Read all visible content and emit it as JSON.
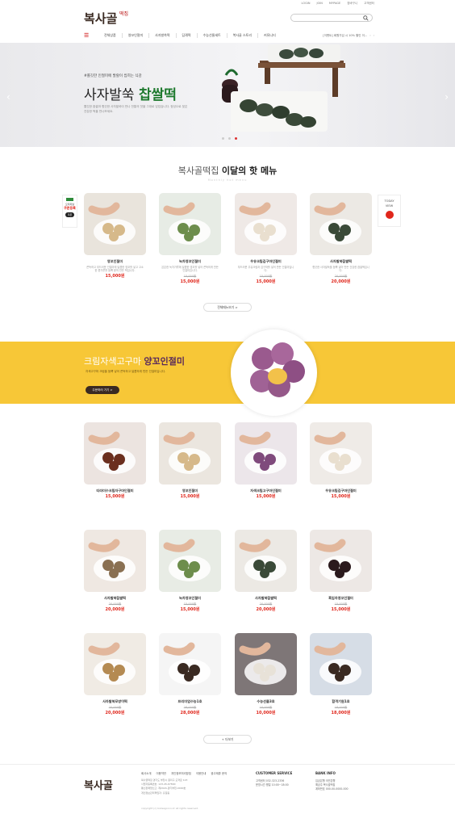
{
  "top_links": [
    "LOGIN",
    "JOIN",
    "MYPAGE",
    "장바구니",
    "고객센터"
  ],
  "brand": {
    "name": "복사골",
    "sub": "떡집"
  },
  "nav": {
    "items": [
      "전체상품",
      "영꼬인절미",
      "사자발쑥떡",
      "답례떡",
      "수능선물세트",
      "복사골 스토리",
      "커뮤니티"
    ],
    "notice": "[이벤트] 회원가입 시 10% 할인 이..."
  },
  "hero": {
    "kicker": "#쫄깃한 인절미에 발랄이 씹히는 식감",
    "title_pre": "사자발쑥 ",
    "title_bold": "찹쌀떡",
    "desc": "쫄깃한 찹쌀과 향긋한 사자발쑥이 만나 전통의 맛을 그대로 담았습니다. 정성으로 빚은 건강한 떡을 만나보세요."
  },
  "monthly": {
    "title_pre": "복사골떡집 ",
    "title_bold": "이달의 핫 메뉴",
    "sub": "Monthly hot menu",
    "more": "전체메뉴보기 >"
  },
  "side_left": {
    "top": "오리지날",
    "mid": "오리지날",
    "red": "쿠폰등록",
    "btn": "쿠폰"
  },
  "side_right": {
    "l1": "TODAY",
    "l2": "VIEW"
  },
  "hot_products": [
    {
      "name": "영꼬인절미",
      "desc": "쫀득하고 부드러운 인절미에 달콤한 영꼬를 넣고 고소한 콩가루를 듬뿍 묻혀 만든 떡입니다.",
      "old": "",
      "price": "15,000원"
    },
    {
      "name": "녹차영꼬인절미",
      "desc": "은은한 녹차가루에 달콤한 영꼬를 넣어 쫀득하게 만든 인절미입니다.",
      "old": "15,000원",
      "price": "15,000원"
    },
    {
      "name": "우유크림김구마인절미",
      "desc": "부드러운 우유크림과 김구마를 넣어 만든 인절미입니다.",
      "old": "15,000원",
      "price": "15,000원"
    },
    {
      "name": "사자발쑥찹쌀떡",
      "desc": "향긋한 사자발쑥을 듬뿍 넣어 만든 건강한 찹쌀떡입니다.",
      "old": "20,000원",
      "price": "20,000원"
    }
  ],
  "yellow_banner": {
    "title_pre": "크림자색고구마 ",
    "title_bold": "양꼬인절미",
    "sub": "자색고구마 크림을 듬뿍 넣어 쫀득하고 달콤하게 만든 인절미입니다.",
    "btn": "주문하러 가기 >"
  },
  "products": [
    {
      "name": "티라미수크림자구마인절미",
      "desc": "",
      "old": "",
      "price": "15,000원"
    },
    {
      "name": "영꼬인절미",
      "desc": "",
      "old": "",
      "price": "15,000원"
    },
    {
      "name": "자색크림고구마인절미",
      "desc": "",
      "old": "",
      "price": "15,000원"
    },
    {
      "name": "우유크림김구마인절미",
      "desc": "",
      "old": "",
      "price": "15,000원"
    },
    {
      "name": "사자발쑥찹쌀떡",
      "desc": "",
      "old": "20,000원",
      "price": "20,000원"
    },
    {
      "name": "녹차영꼬인절미",
      "desc": "",
      "old": "15,000원",
      "price": "15,000원"
    },
    {
      "name": "사자발쑥찹쌀떡",
      "desc": "",
      "old": "20,000원",
      "price": "20,000원"
    },
    {
      "name": "흑임자영꼬인절미",
      "desc": "",
      "old": "15,000원",
      "price": "15,000원"
    },
    {
      "name": "사자발쑥모방이떡",
      "desc": "",
      "old": "20,000원",
      "price": "20,000원"
    },
    {
      "name": "프리미엄수능1호",
      "desc": "",
      "old": "28,000원",
      "price": "28,000원"
    },
    {
      "name": "수능선물3호",
      "desc": "",
      "old": "10,000원",
      "price": "10,000원"
    },
    {
      "name": "합격기원1호",
      "desc": "",
      "old": "18,000원",
      "price": "18,000원"
    }
  ],
  "more2": "+ 더보기",
  "footer": {
    "nav": [
      "회사소개",
      "이용약관",
      "개인정보처리방침",
      "이용안내",
      "광고제휴 문의"
    ],
    "info": [
      "복사골떡집 경기도 부천시 원미구 도약로 123",
      "사업자등록번호: 123-45-67890",
      "통신판매업신고: 제2024-경기부천-0000호",
      "개인정보관리책임자: 홍길동"
    ],
    "copy": "copyright (c) boksagol.co.kr all rights reserved.",
    "cs_title": "CUSTOMER SERVICE",
    "cs": [
      "고객센터 032-323-2336",
      "운영시간 평일 10:00~18:00"
    ],
    "bank_title": "BANK INFO",
    "bank": [
      "입금은행 국민은행",
      "예금주 복사골떡집",
      "계좌번호 000-00-0000-000"
    ]
  }
}
